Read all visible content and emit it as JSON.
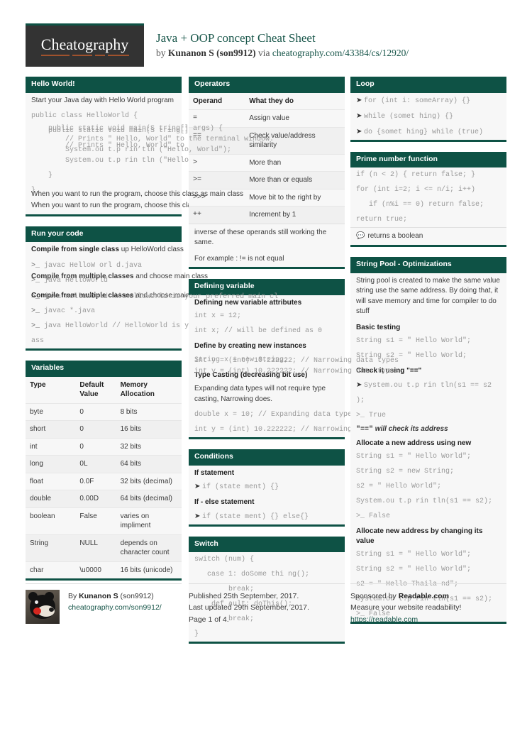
{
  "header": {
    "logo": "Cheatography",
    "title": "Java + OOP concept Cheat Sheet",
    "byline_prefix": "by ",
    "author": "Kunanon S (son9912)",
    "byline_mid": " via ",
    "source_url": "cheatography.com/43384/cs/12920/"
  },
  "hello_world": {
    "title": "Hello World!",
    "intro": "Start your Java day with Hello World program",
    "code": [
      "public class HelloWorld {",
      "    public static void main(S tring[] args) {",
      "        // Prints \" Hello, World\" to the terminal window.",
      "        System.ou t.p rin tln (\"Hello, World\");",
      "    }",
      "}"
    ],
    "footnote": "When you want to run the program, choose this class as main class"
  },
  "run_your_code": {
    "title": "Run your code",
    "sub1_bold": "Compile from single class",
    "sub1_rest": " up HelloWorld class",
    "cmd1": "javac HelloW orl d.java",
    "cmd2": "java HelloWorld",
    "sub2_bold": "Compile from multiple classes",
    "sub2_rest": " and choose main class",
    "cmd3": "javac *.java",
    "cmd4": "java HelloWorld // HelloWorld is your preferred main cl",
    "cmd4_overflow": "ass",
    "prompt": ">_"
  },
  "variables": {
    "title": "Variables",
    "columns": [
      "Type",
      "Default Value",
      "Memory Allocation"
    ],
    "rows": [
      [
        "byte",
        "0",
        "8 bits"
      ],
      [
        "short",
        "0",
        "16 bits"
      ],
      [
        "int",
        "0",
        "32 bits"
      ],
      [
        "long",
        "0L",
        "64 bits"
      ],
      [
        "float",
        "0.0F",
        "32 bits (decimal)"
      ],
      [
        "double",
        "0.00D",
        "64 bits (decimal)"
      ],
      [
        "boolean",
        "False",
        "varies on impliment"
      ],
      [
        "String",
        "NULL",
        "depends on character count"
      ],
      [
        "char",
        "\\u0000",
        "16 bits (unicode)"
      ]
    ]
  },
  "operators": {
    "title": "Operators",
    "columns": [
      "Operand",
      "What they do"
    ],
    "rows": [
      [
        "=",
        "Assign value"
      ],
      [
        "==",
        "Check value/address similarity"
      ],
      [
        ">",
        "More than"
      ],
      [
        ">=",
        "More than or equals"
      ],
      [
        ">>>",
        "Move bit to the right by"
      ],
      [
        "++",
        "Increment by 1"
      ]
    ],
    "note_line1": "inverse of these operands still working the same.",
    "note_line2": "For example : != is not equal"
  },
  "defining_variable": {
    "title": "Defining variable",
    "sub1": "Defining new variable attributes",
    "code1": "int x = 12;",
    "code2": "int x; // will be defined as 0",
    "sub2": "Define by creating new instances",
    "code3": "String x = new String;",
    "sub3": "Type Casting (decreasing bit use)",
    "para": "Expanding data types will not require type casting, Narrowing does.",
    "code4": "double x = 10; // Expanding data types",
    "code5": "int y = (int) 10.222222; // Narrowing data types"
  },
  "conditions": {
    "title": "Conditions",
    "sub1": "If statement",
    "code1": "if (state ment) {}",
    "sub2": "If - else statement",
    "code2": "if (state ment) {} else{}"
  },
  "switch": {
    "title": "Switch",
    "code": [
      "switch (num) {",
      "   case 1: doSome thi ng();",
      "        break;",
      "    def ault: doThis();",
      "        break;",
      "}"
    ]
  },
  "loop": {
    "title": "Loop",
    "items": [
      "for (int i: someArray) {}",
      "while (somet hing) {}",
      "do {somet hing} while (true)"
    ]
  },
  "prime": {
    "title": "Prime number function",
    "code": [
      "if (n < 2) { return false; }",
      "for (int i=2; i <= n/i; i++)",
      "   if (n%i == 0) return false;",
      "return true;"
    ],
    "note": "returns a boolean"
  },
  "string_pool": {
    "title": "String Pool - Optimizations",
    "intro": "String pool is created to make the same value string use the same address. By doing that, it will save memory and time for compiler to do stuff",
    "sub1": "Basic testing",
    "code1": "String s1 = \" Hello World\";",
    "code2": "String s2 = \" Hello World;",
    "sub2_prefix": "Check it using ",
    "sub2_mono": "\"==\"",
    "code3": "System.ou t.p rin tln(s1 == s2",
    "code3b": ");",
    "out1": ">_ True",
    "italic_note_mono": "\"==\"",
    "italic_note_text": " will check its address",
    "sub3_prefix": "Allocate a new address using ",
    "sub3_mono": "new",
    "code4": "String s1 = \" Hello World\";",
    "code5": "String s2 = new String;",
    "code6": "s2 = \" Hello World\";",
    "code7": "System.ou t.p rin tln(s1 == s2);",
    "out2": ">_ False",
    "sub4": "Allocate new address by changing its value",
    "code8": "String s1 = \" Hello World\";",
    "code9": "String s2 = \" Hello World\";",
    "code10": "s2 = \" Hello Thaila nd\";",
    "code11": "System.ou t.p rin tln(s1 == s2);",
    "out3": ">_ False"
  },
  "footer": {
    "by_prefix": "By ",
    "author": "Kunanon S",
    "author_handle": " (son9912)",
    "author_url": "cheatography.com/son9912/",
    "published": "Published 25th September, 2017.",
    "updated": "Last updated 29th September, 2017.",
    "page": "Page 1 of 4.",
    "sponsor_prefix": "Sponsored by ",
    "sponsor_name": "Readable.com",
    "sponsor_tagline": "Measure your website readability!",
    "sponsor_url": "https://readable.com"
  },
  "colors": {
    "accent": "#0e5245",
    "link": "#18564a",
    "logo_bg": "#333333",
    "logo_underline": "#a0522d",
    "card_bg": "#f7f7f7"
  }
}
